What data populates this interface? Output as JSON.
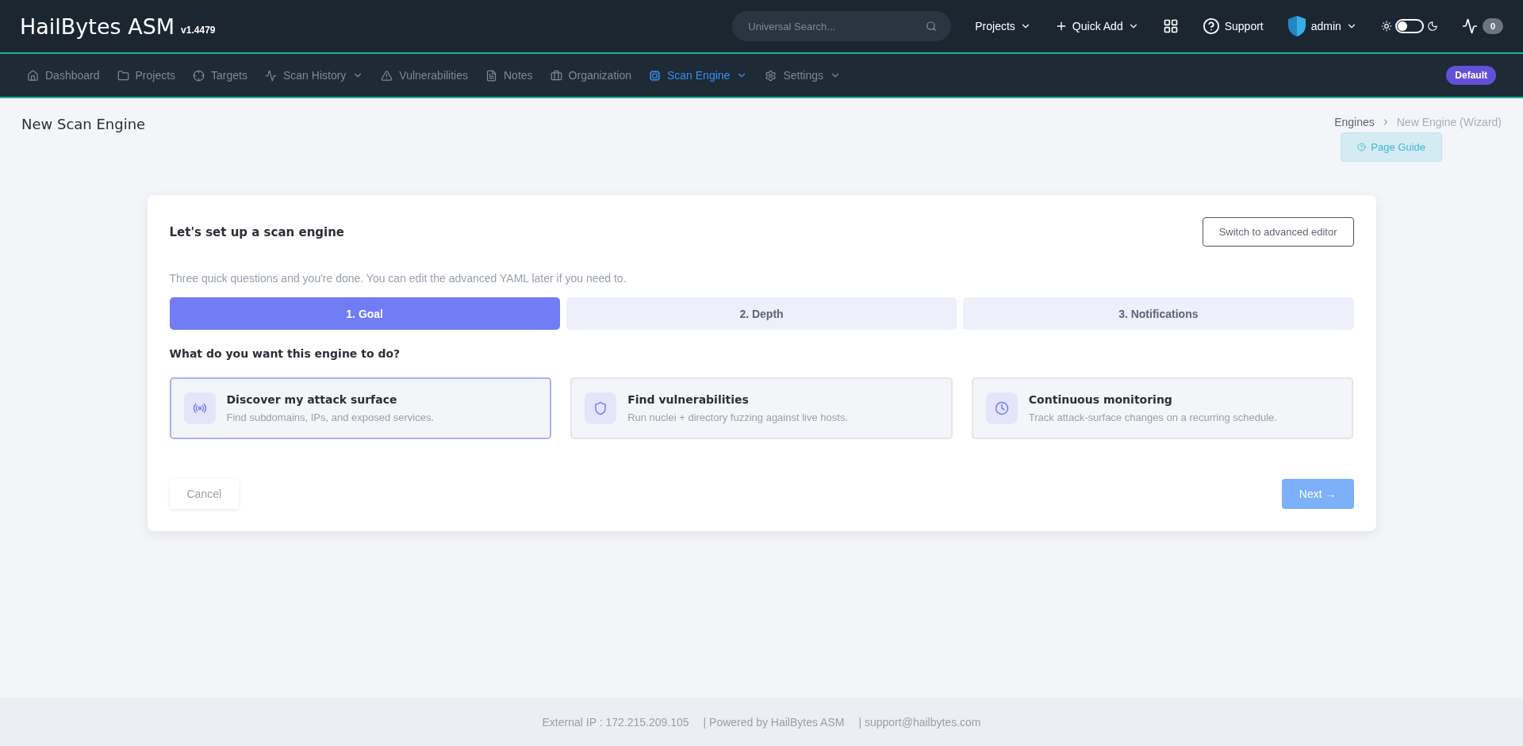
{
  "header": {
    "brand": "HailBytes ASM",
    "version": "v1.4479",
    "search": {
      "placeholder": "Universal Search..."
    },
    "actions": [
      {
        "kind": "menu",
        "label": "Projects"
      },
      {
        "kind": "add",
        "label": "Quick Add"
      },
      {
        "kind": "grid"
      },
      {
        "kind": "help",
        "label": "Support"
      },
      {
        "kind": "user",
        "label": "admin"
      }
    ],
    "theme_toggle": {
      "on": false
    },
    "activity_count": "0"
  },
  "nav": {
    "items": [
      {
        "label": "Dashboard",
        "selected": false,
        "dropdown": false
      },
      {
        "label": "Projects",
        "selected": false,
        "dropdown": false
      },
      {
        "label": "Targets",
        "selected": false,
        "dropdown": false
      },
      {
        "label": "Scan History",
        "selected": false,
        "dropdown": true
      },
      {
        "label": "Vulnerabilities",
        "selected": false,
        "dropdown": false
      },
      {
        "label": "Notes",
        "selected": false,
        "dropdown": false
      },
      {
        "label": "Organization",
        "selected": false,
        "dropdown": false
      },
      {
        "label": "Scan Engine",
        "selected": true,
        "dropdown": true
      },
      {
        "label": "Settings",
        "selected": false,
        "dropdown": true
      }
    ],
    "project_badge": "Default"
  },
  "page": {
    "title": "New Scan Engine",
    "breadcrumbs": [
      "Engines",
      "New Engine (Wizard)"
    ],
    "guide_button": "Page Guide"
  },
  "wizard": {
    "title": "Let's set up a scan engine",
    "advanced_button": "Switch to advanced editor",
    "intro": "Three quick questions and you're done. You can edit the advanced YAML later if you need to.",
    "steps": [
      {
        "label": "1. Goal",
        "selected": true
      },
      {
        "label": "2. Depth",
        "selected": false
      },
      {
        "label": "3. Notifications",
        "selected": false
      }
    ],
    "question": "What do you want this engine to do?",
    "options": [
      {
        "title": "Discover my attack surface",
        "description": "Find subdomains, IPs, and exposed services.",
        "selected": true
      },
      {
        "title": "Find vulnerabilities",
        "description": "Run nuclei + directory fuzzing against live hosts.",
        "selected": false
      },
      {
        "title": "Continuous monitoring",
        "description": "Track attack-surface changes on a recurring schedule.",
        "selected": false
      }
    ],
    "cancel_button": "Cancel",
    "next_button": "Next →"
  },
  "footer": [
    "External IP : 172.215.209.105",
    "| Powered by HailBytes ASM",
    "| support@hailbytes.com"
  ]
}
